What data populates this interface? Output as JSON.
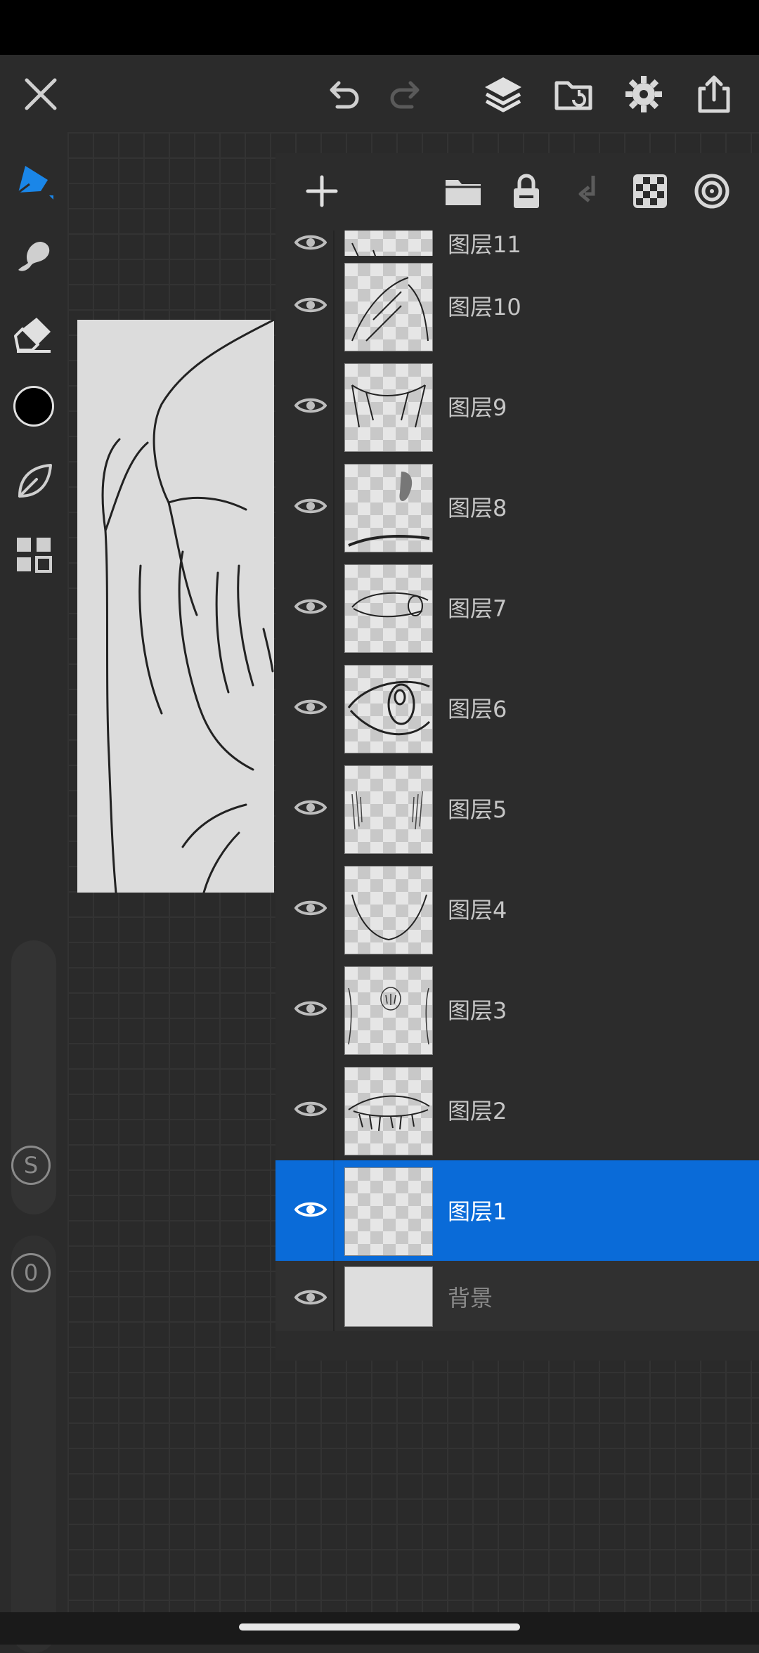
{
  "toolbar": {
    "close": "close-icon",
    "undo": "undo-icon",
    "redo": "redo-icon",
    "layers": "layers-icon",
    "gallery": "import-icon",
    "settings": "gear-icon",
    "export": "share-icon"
  },
  "sidebar": {
    "tools": [
      "pen-icon",
      "smudge-icon",
      "eraser-icon",
      "color-icon",
      "leaf-icon",
      "grid-icon"
    ],
    "active_color": "#000000",
    "size_badge": "S",
    "opacity_badge": "0"
  },
  "layers_panel": {
    "buttons": [
      "add-icon",
      "folder-icon",
      "lock-icon",
      "merge-down-icon",
      "checker-icon",
      "blend-icon"
    ],
    "partial_top_label": "图层11",
    "layers": [
      {
        "name": "图层10",
        "selected": false
      },
      {
        "name": "图层9",
        "selected": false
      },
      {
        "name": "图层8",
        "selected": false
      },
      {
        "name": "图层7",
        "selected": false
      },
      {
        "name": "图层6",
        "selected": false
      },
      {
        "name": "图层5",
        "selected": false
      },
      {
        "name": "图层4",
        "selected": false
      },
      {
        "name": "图层3",
        "selected": false
      },
      {
        "name": "图层2",
        "selected": false
      },
      {
        "name": "图层1",
        "selected": true
      }
    ],
    "background_label": "背景"
  },
  "colors": {
    "accent": "#0a6bd8",
    "panel": "#2c2c2c",
    "background": "#2a2a2a"
  }
}
